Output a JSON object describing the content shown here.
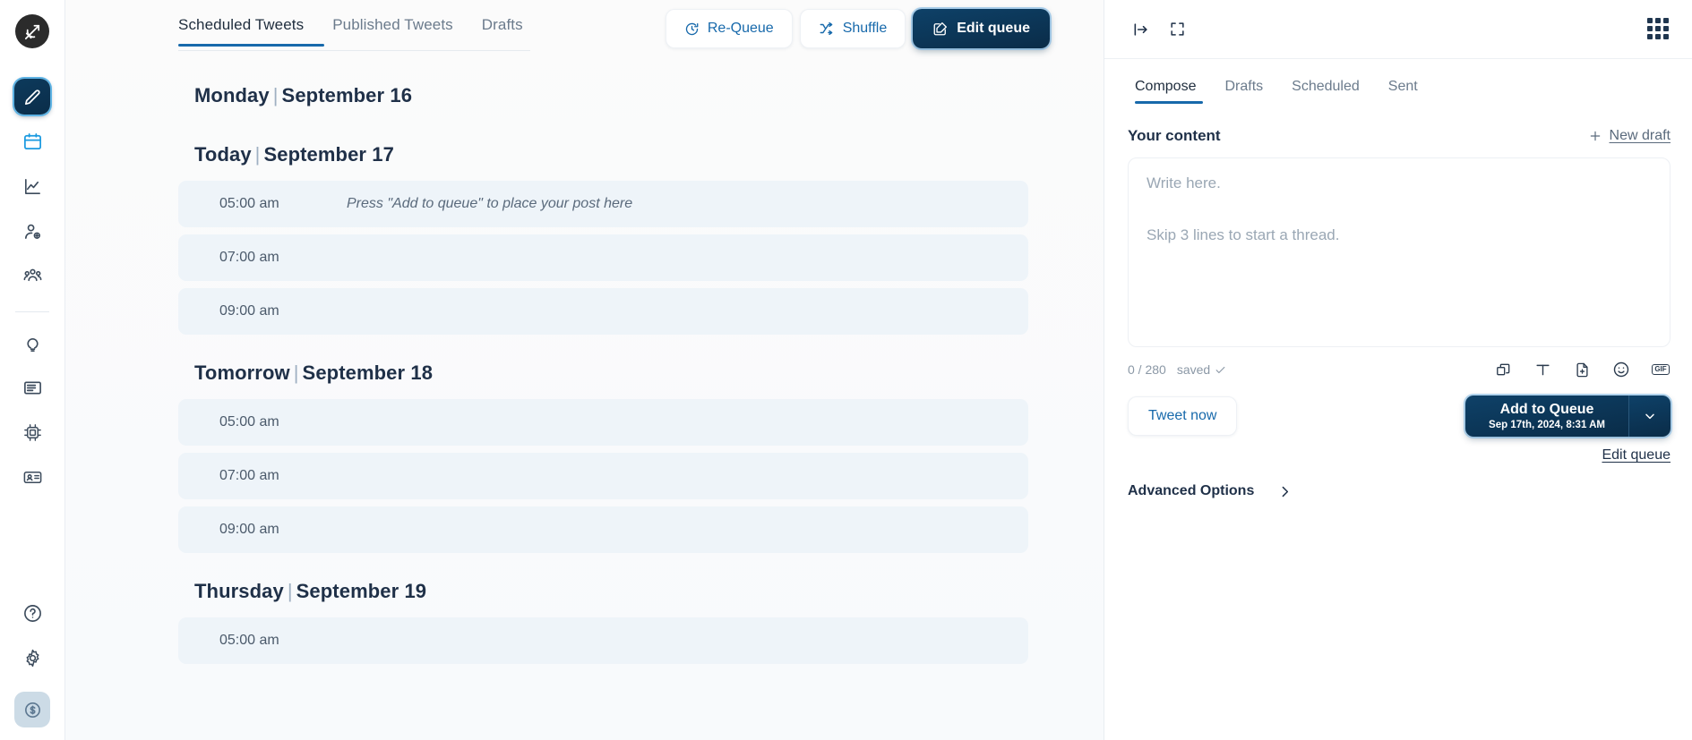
{
  "sidebar": {
    "logo": {
      "name": "hypefury-logo",
      "icon": "bow-and-arrow-icon"
    },
    "items": [
      {
        "icon": "pencil-compose-icon",
        "active": true
      },
      {
        "icon": "calendar-icon",
        "active": false
      },
      {
        "icon": "analytics-chart-icon",
        "active": false
      },
      {
        "icon": "user-plus-icon",
        "active": false
      },
      {
        "icon": "group-users-icon",
        "active": false
      },
      {
        "icon": "lightbulb-icon",
        "active": false
      },
      {
        "icon": "newspaper-icon",
        "active": false
      },
      {
        "icon": "ai-chip-icon",
        "active": false
      },
      {
        "icon": "id-card-icon",
        "active": false
      }
    ],
    "bottom_items": [
      {
        "icon": "help-circle-icon"
      },
      {
        "icon": "gear-settings-icon"
      },
      {
        "icon": "dollar-credits-icon"
      }
    ]
  },
  "main": {
    "tabs": [
      {
        "label": "Scheduled Tweets",
        "active": true
      },
      {
        "label": "Published Tweets",
        "active": false
      },
      {
        "label": "Drafts",
        "active": false
      }
    ],
    "actions": [
      {
        "label": "Re-Queue",
        "icon": "clock-refresh-icon",
        "style": "secondary"
      },
      {
        "label": "Shuffle",
        "icon": "shuffle-icon",
        "style": "secondary"
      },
      {
        "label": "Edit queue",
        "icon": "edit-square-icon",
        "style": "primary"
      }
    ],
    "days": [
      {
        "weekday": "Monday",
        "separator": "|",
        "date": "September 16",
        "slots": []
      },
      {
        "weekday": "Today",
        "separator": "|",
        "date": "September 17",
        "slots": [
          {
            "time": "05:00 am",
            "hint": "Press \"Add to queue\" to place your post here"
          },
          {
            "time": "07:00 am",
            "hint": ""
          },
          {
            "time": "09:00 am",
            "hint": ""
          }
        ]
      },
      {
        "weekday": "Tomorrow",
        "separator": "|",
        "date": "September 18",
        "slots": [
          {
            "time": "05:00 am",
            "hint": ""
          },
          {
            "time": "07:00 am",
            "hint": ""
          },
          {
            "time": "09:00 am",
            "hint": ""
          }
        ]
      },
      {
        "weekday": "Thursday",
        "separator": "|",
        "date": "September 19",
        "slots": [
          {
            "time": "05:00 am",
            "hint": ""
          }
        ]
      }
    ]
  },
  "right_panel": {
    "top_icons": [
      {
        "icon": "collapse-panel-icon"
      },
      {
        "icon": "expand-fullscreen-icon"
      },
      {
        "icon": "apps-grid-icon"
      }
    ],
    "tabs": [
      {
        "label": "Compose",
        "active": true
      },
      {
        "label": "Drafts",
        "active": false
      },
      {
        "label": "Scheduled",
        "active": false
      },
      {
        "label": "Sent",
        "active": false
      }
    ],
    "content_title": "Your content",
    "new_draft": {
      "label": "New draft",
      "icon": "plus-icon"
    },
    "composer": {
      "placeholder_main": "Write here.",
      "placeholder_thread": "Skip 3 lines to start a thread.",
      "value": ""
    },
    "counter": "0 / 280",
    "saved_label": "saved",
    "toolbar": [
      {
        "icon": "duplicate-post-icon"
      },
      {
        "icon": "text-format-icon"
      },
      {
        "icon": "add-file-icon"
      },
      {
        "icon": "emoji-icon"
      },
      {
        "icon": "gif-icon",
        "label": "GIF"
      }
    ],
    "tweet_now_label": "Tweet now",
    "add_to_queue": {
      "label": "Add to Queue",
      "schedule": "Sep 17th, 2024, 8:31 AM",
      "caret_icon": "chevron-down-icon"
    },
    "edit_queue_link": "Edit queue",
    "advanced_options": {
      "label": "Advanced Options",
      "icon": "chevron-right-icon"
    }
  },
  "colors": {
    "accent_blue": "#1769ab",
    "primary_dark": "#0a2c48",
    "slot_bg": "#eef4f9",
    "text_dark": "#1f3048",
    "text_muted": "#6b7b8c"
  }
}
